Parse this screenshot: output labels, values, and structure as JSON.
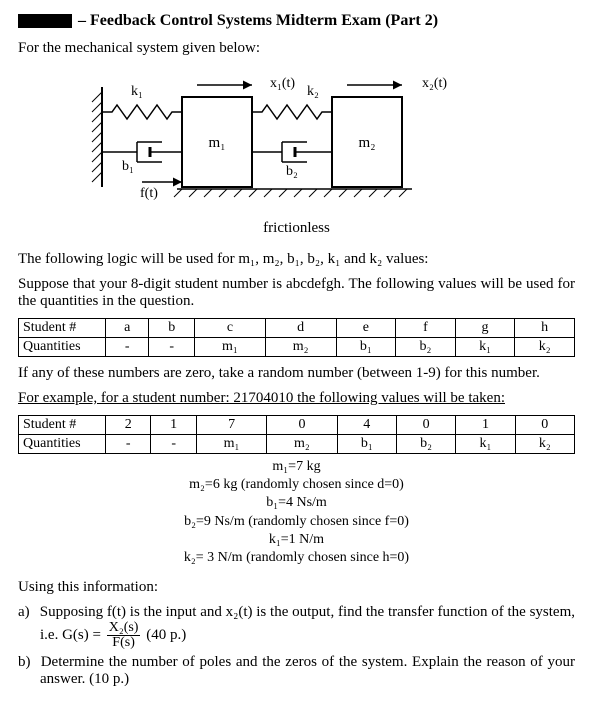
{
  "header": {
    "title": "– Feedback Control Systems Midterm Exam (Part 2)"
  },
  "intro": "For the mechanical system given below:",
  "diagram_labels": {
    "k1": "k₁",
    "b1": "b₁",
    "ft": "f(t)",
    "m1": "m₁",
    "x1": "x₁(t)",
    "k2": "k₂",
    "b2": "b₂",
    "m2": "m₂",
    "x2": "x₂(t)"
  },
  "frictionless": "frictionless",
  "logic_sentence": "The following logic will be used for m₁, m₂, b₁, b₂, k₁ and k₂ values:",
  "suppose": "Suppose that your 8-digit student number is abcdefgh. The following values will be used for the quantities in the question.",
  "table1": {
    "rows": [
      {
        "label": "Student #",
        "cells": [
          "a",
          "b",
          "c",
          "d",
          "e",
          "f",
          "g",
          "h"
        ]
      },
      {
        "label": "Quantities",
        "cells": [
          "-",
          "-",
          "m₁",
          "m₂",
          "b₁",
          "b₂",
          "k₁",
          "k₂"
        ]
      }
    ]
  },
  "zero_note": "If any of these numbers are zero, take a random number (between 1-9) for this number.",
  "example_line": "For example, for a student number: 21704010 the following values will be taken:",
  "table2": {
    "rows": [
      {
        "label": "Student #",
        "cells": [
          "2",
          "1",
          "7",
          "0",
          "4",
          "0",
          "1",
          "0"
        ]
      },
      {
        "label": "Quantities",
        "cells": [
          "-",
          "-",
          "m₁",
          "m₂",
          "b₁",
          "b₂",
          "k₁",
          "k₂"
        ]
      }
    ]
  },
  "params": [
    "m₁=7 kg",
    "m₂=6 kg (randomly chosen since d=0)",
    "b₁=4 Ns/m",
    "b₂=9 Ns/m (randomly chosen since f=0)",
    "k₁=1 N/m",
    "k₂= 3 N/m (randomly chosen since h=0)"
  ],
  "using": "Using this information:",
  "qa": {
    "letter": "a)",
    "text_before": "Supposing f(t) is the input and x₂(t) is the output, find the transfer function of the system, i.e. G(s) = ",
    "frac_num": "X₂(s)",
    "frac_den": "F(s)",
    "points": " (40 p.)"
  },
  "qb": {
    "letter": "b)",
    "text": "Determine the number of poles and the zeros of the system. Explain the reason of your answer. (10 p.)"
  },
  "chart_data": {
    "type": "table",
    "description": "Mapping of 8-digit student number digits to mechanical-system parameters",
    "mapping_generic": [
      {
        "digit_pos": "a",
        "quantity": "-"
      },
      {
        "digit_pos": "b",
        "quantity": "-"
      },
      {
        "digit_pos": "c",
        "quantity": "m1"
      },
      {
        "digit_pos": "d",
        "quantity": "m2"
      },
      {
        "digit_pos": "e",
        "quantity": "b1"
      },
      {
        "digit_pos": "f",
        "quantity": "b2"
      },
      {
        "digit_pos": "g",
        "quantity": "k1"
      },
      {
        "digit_pos": "h",
        "quantity": "k2"
      }
    ],
    "example_student_number": "21704010",
    "example_mapping": [
      {
        "digit": "2",
        "quantity": "-"
      },
      {
        "digit": "1",
        "quantity": "-"
      },
      {
        "digit": "7",
        "quantity": "m1"
      },
      {
        "digit": "0",
        "quantity": "m2"
      },
      {
        "digit": "4",
        "quantity": "b1"
      },
      {
        "digit": "0",
        "quantity": "b2"
      },
      {
        "digit": "1",
        "quantity": "k1"
      },
      {
        "digit": "0",
        "quantity": "k2"
      }
    ],
    "resolved_parameters": {
      "m1_kg": 7,
      "m2_kg": 6,
      "b1_Ns_per_m": 4,
      "b2_Ns_per_m": 9,
      "k1_N_per_m": 1,
      "k2_N_per_m": 3
    }
  }
}
